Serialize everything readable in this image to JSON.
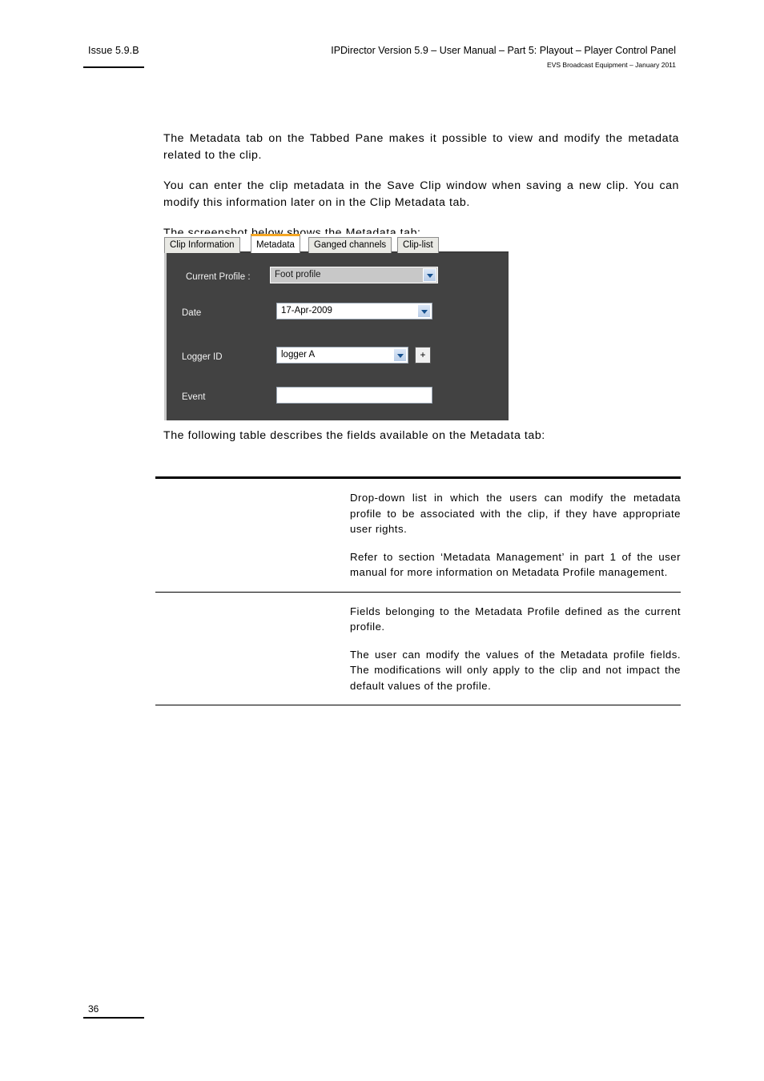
{
  "header": {
    "issue": "Issue 5.9.B",
    "title": "IPDirector Version 5.9 – User Manual – Part 5: Playout – Player Control Panel",
    "subtitle": "EVS Broadcast Equipment – January 2011"
  },
  "body": {
    "paragraphs": [
      "The Metadata tab on the Tabbed Pane makes it possible to view and modify the metadata related to the clip.",
      "You can enter the clip metadata in the Save Clip window when saving a new clip. You can modify this information later on in the Clip Metadata tab.",
      "The screenshot below shows the Metadata tab:"
    ],
    "table_intro": "The following table describes the fields available on the Metadata tab:"
  },
  "screenshot": {
    "tabs": [
      {
        "label": "Clip Information",
        "active": false
      },
      {
        "label": "Metadata",
        "active": true
      },
      {
        "label": "Ganged channels",
        "active": false
      },
      {
        "label": "Clip-list",
        "active": false
      }
    ],
    "fields": [
      {
        "label": "Current Profile :",
        "value": "Foot profile",
        "control": "dropdown",
        "disabled": true,
        "has_plus": false
      },
      {
        "label": "Date",
        "value": "17-Apr-2009",
        "control": "dropdown",
        "disabled": false,
        "has_plus": false
      },
      {
        "label": "Logger ID",
        "value": "logger A",
        "control": "dropdown",
        "disabled": false,
        "has_plus": true
      },
      {
        "label": "Event",
        "value": "",
        "control": "text",
        "disabled": false,
        "has_plus": false
      }
    ],
    "plus_label": "+",
    "accent_color": "#f5a623",
    "panel_color": "#424242"
  },
  "desc_table": {
    "rows": [
      {
        "term": "",
        "paragraphs": [
          "Drop-down list in which the users can modify the metadata profile to be associated with the clip, if they have appropriate user rights.",
          "Refer to section ‘Metadata Management’ in part 1 of the user manual for more information on Metadata Profile management."
        ]
      },
      {
        "term": "",
        "paragraphs": [
          "Fields belonging to the Metadata Profile defined as the current profile.",
          "The user can modify the values of the Metadata profile fields. The modifications will only apply to the clip and not impact the default values of the profile."
        ]
      }
    ]
  },
  "footer": {
    "page_number": "36"
  }
}
